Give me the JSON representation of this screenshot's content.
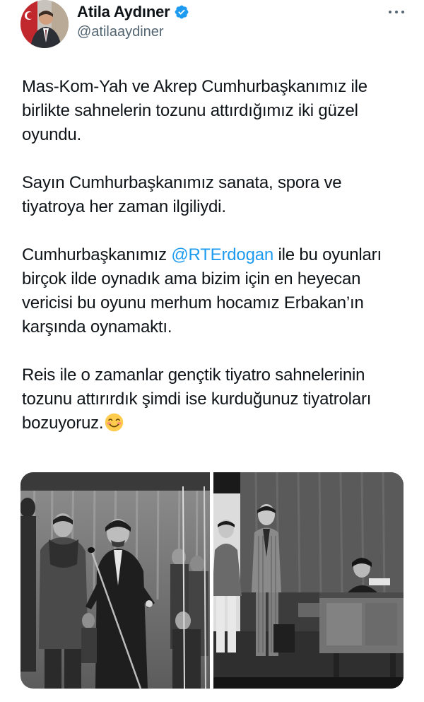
{
  "user": {
    "display_name": "Atila Aydıner",
    "handle": "@atilaaydiner",
    "verified_icon": "verified-badge-icon",
    "colors": {
      "verified": "#1d9bf0"
    }
  },
  "tweet": {
    "paragraphs": [
      {
        "text": "Mas-Kom-Yah ve Akrep Cumhurbaşkanımız ile birlikte sahnelerin tozunu attırdığımız iki güzel oyundu."
      },
      {
        "text": "Sayın Cumhurbaşkanımız sanata, spora ve tiyatroya her zaman ilgiliydi."
      },
      {
        "before": "Cumhurbaşkanımız ",
        "mention": "@RTErdogan",
        "after": " ile bu oyunları birçok ilde oynadık ama bizim için en heyecan vericisi bu oyunu merhum hocamız Erbakan’ın karşında oynamaktı."
      },
      {
        "text": "Reis ile o zamanlar gençtik tiyatro sahnelerinin tozunu attırırdık şimdi ise kurduğunuz tiyatroları bozuyoruz.",
        "emoji": "smiling-face-icon"
      }
    ],
    "colors": {
      "text": "#0f1419",
      "mention": "#1d9bf0",
      "secondary": "#536471"
    }
  },
  "media": {
    "photos": [
      {
        "name": "photo-stage-microphone"
      },
      {
        "name": "photo-stage-desk"
      }
    ]
  }
}
